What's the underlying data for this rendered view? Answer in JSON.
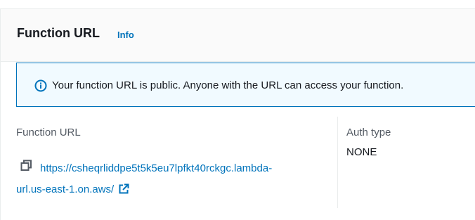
{
  "panel": {
    "title": "Function URL",
    "info_label": "Info"
  },
  "alert": {
    "icon": "info-circle-icon",
    "message": "Your function URL is public. Anyone with the URL can access your function."
  },
  "function_url": {
    "label": "Function URL",
    "url_line1": "https://csheqrliddpe5t5k5eu7lpfkt40rckgc.lambda-",
    "url_line2": "url.us-east-1.on.aws/",
    "copy_icon": "copy-icon",
    "external_icon": "external-link-icon"
  },
  "auth": {
    "label": "Auth type",
    "value": "NONE"
  },
  "colors": {
    "link": "#0073bb",
    "alert_bg": "#f1faff",
    "header_bg": "#fafafa"
  }
}
